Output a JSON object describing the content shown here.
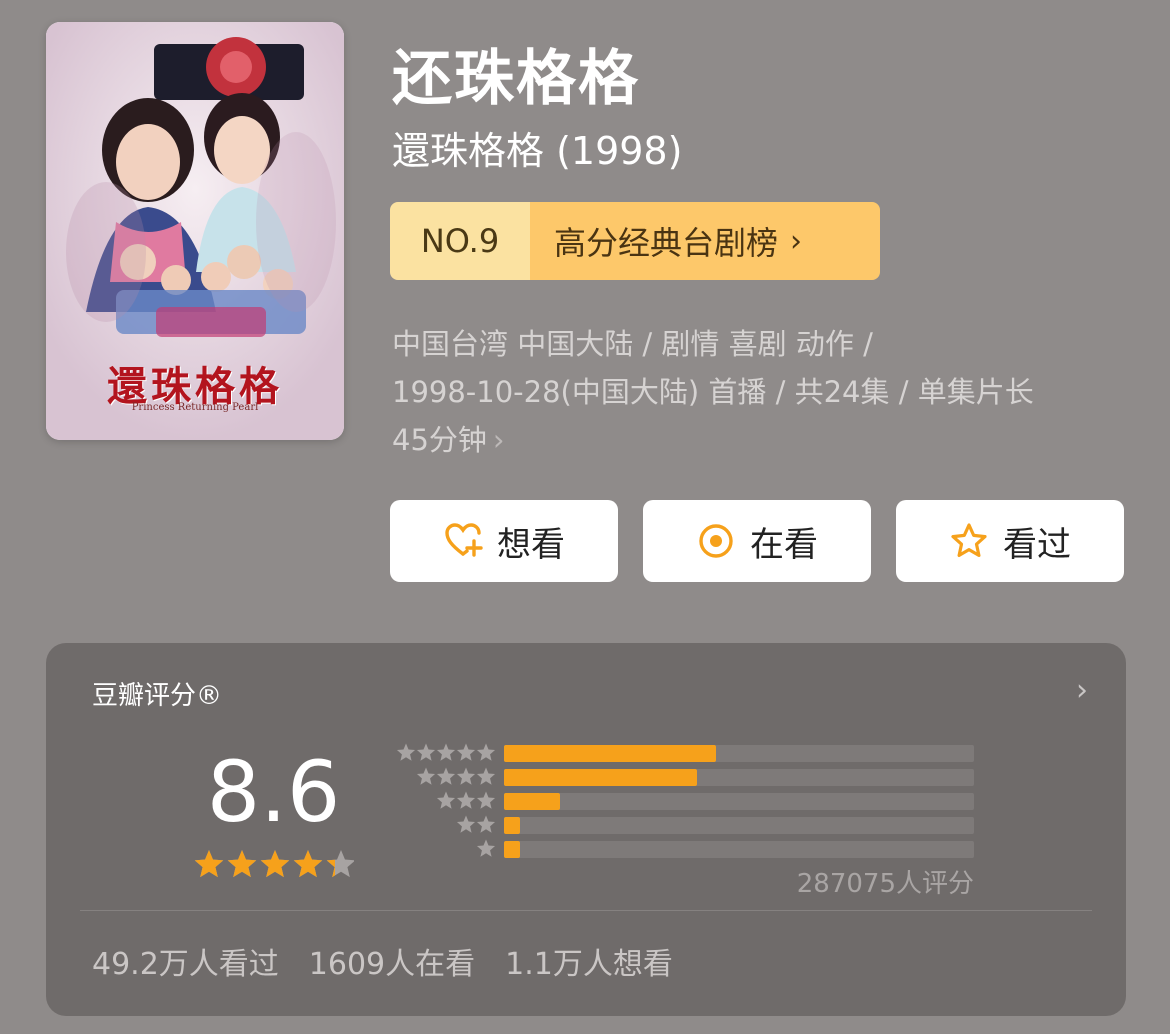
{
  "poster": {
    "title_text": "還珠格格",
    "subtitle_text": "Princess Returning Pearl"
  },
  "title": "还珠格格",
  "original_title": "還珠格格 (1998)",
  "ranking": {
    "number": "NO.9",
    "name": "高分经典台剧榜",
    "chevron": "›"
  },
  "info": {
    "line1": "中国台湾 中国大陆 / 剧情 喜剧 动作 /",
    "line2": "1998-10-28(中国大陆) 首播 / 共24集 / 单集片长",
    "line3": "45分钟",
    "chevron": "›"
  },
  "actions": {
    "want_label": "想看",
    "watching_label": "在看",
    "watched_label": "看过"
  },
  "rating": {
    "title": "豆瓣评分®",
    "chevron": "›",
    "score": "8.6",
    "stars_value": 4.3,
    "distribution_fractions": [
      0.45,
      0.41,
      0.12,
      0.035,
      0.035
    ],
    "count_text": "287075人评分",
    "watched": "49.2万人看过",
    "watching": "1609人在看",
    "wishlist": "1.1万人想看"
  },
  "colors": {
    "accent": "#f6a11b",
    "background": "#8f8b8a",
    "card": "#6f6b6a",
    "rank_light": "#fbe2a1",
    "rank_dark": "#fdc86a"
  },
  "icons": {
    "want": "heart-plus-icon",
    "watching": "target-circle-icon",
    "watched": "star-outline-icon"
  }
}
